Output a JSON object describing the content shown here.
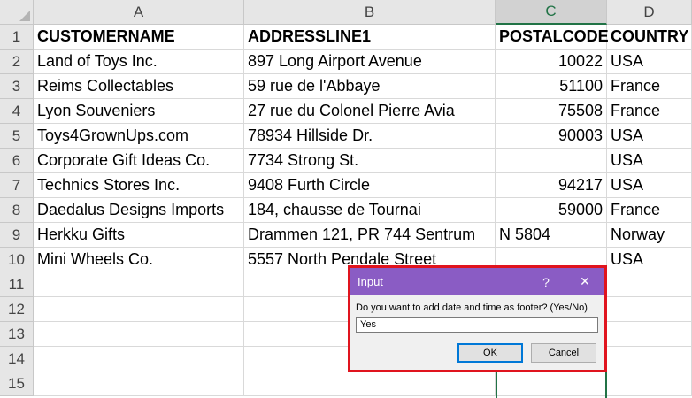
{
  "sheet": {
    "columns": [
      "A",
      "B",
      "C",
      "D"
    ],
    "active_column": "C",
    "row_numbers": [
      "1",
      "2",
      "3",
      "4",
      "5",
      "6",
      "7",
      "8",
      "9",
      "10",
      "11",
      "12",
      "13",
      "14",
      "15"
    ],
    "rows": [
      [
        "CUSTOMERNAME",
        "ADDRESSLINE1",
        "POSTALCODE",
        "COUNTRY"
      ],
      [
        "Land of Toys Inc.",
        "897 Long Airport Avenue",
        "10022",
        "USA"
      ],
      [
        "Reims Collectables",
        "59 rue de l'Abbaye",
        "51100",
        "France"
      ],
      [
        "Lyon Souveniers",
        "27 rue du Colonel Pierre Avia",
        "75508",
        "France"
      ],
      [
        "Toys4GrownUps.com",
        "78934 Hillside Dr.",
        "90003",
        "USA"
      ],
      [
        "Corporate Gift Ideas Co.",
        "7734 Strong St.",
        "",
        "USA"
      ],
      [
        "Technics Stores Inc.",
        "9408 Furth Circle",
        "94217",
        "USA"
      ],
      [
        "Daedalus Designs Imports",
        "184, chausse de Tournai",
        "59000",
        "France"
      ],
      [
        "Herkku Gifts",
        "Drammen 121, PR 744 Sentrum",
        "N 5804",
        "Norway"
      ],
      [
        "Mini Wheels Co.",
        "5557 North Pendale Street",
        "",
        "USA"
      ],
      [
        "",
        "",
        "",
        ""
      ],
      [
        "",
        "",
        "",
        ""
      ],
      [
        "",
        "",
        "",
        ""
      ],
      [
        "",
        "",
        "",
        ""
      ],
      [
        "",
        "",
        "",
        ""
      ]
    ]
  },
  "dialog": {
    "title": "Input",
    "help_symbol": "?",
    "close_symbol": "✕",
    "prompt": "Do you want to add date and time as footer? (Yes/No)",
    "input_value": "Yes",
    "ok_label": "OK",
    "cancel_label": "Cancel"
  },
  "colors": {
    "dialog_title_bar": "#8a5cc4",
    "highlight_frame": "#e0141e",
    "selection": "#217346"
  }
}
